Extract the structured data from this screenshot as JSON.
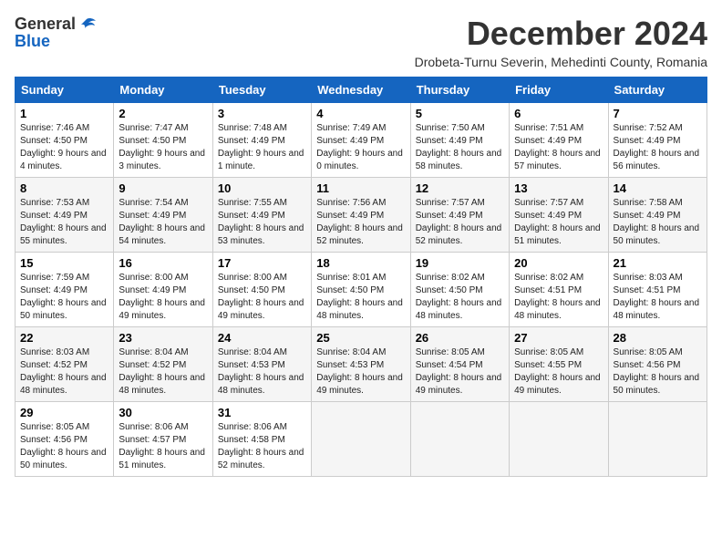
{
  "header": {
    "logo_general": "General",
    "logo_blue": "Blue",
    "title": "December 2024",
    "location": "Drobeta-Turnu Severin, Mehedinti County, Romania"
  },
  "weekdays": [
    "Sunday",
    "Monday",
    "Tuesday",
    "Wednesday",
    "Thursday",
    "Friday",
    "Saturday"
  ],
  "weeks": [
    [
      {
        "day": "1",
        "sunrise": "7:46 AM",
        "sunset": "4:50 PM",
        "daylight": "9 hours and 4 minutes."
      },
      {
        "day": "2",
        "sunrise": "7:47 AM",
        "sunset": "4:50 PM",
        "daylight": "9 hours and 3 minutes."
      },
      {
        "day": "3",
        "sunrise": "7:48 AM",
        "sunset": "4:49 PM",
        "daylight": "9 hours and 1 minute."
      },
      {
        "day": "4",
        "sunrise": "7:49 AM",
        "sunset": "4:49 PM",
        "daylight": "9 hours and 0 minutes."
      },
      {
        "day": "5",
        "sunrise": "7:50 AM",
        "sunset": "4:49 PM",
        "daylight": "8 hours and 58 minutes."
      },
      {
        "day": "6",
        "sunrise": "7:51 AM",
        "sunset": "4:49 PM",
        "daylight": "8 hours and 57 minutes."
      },
      {
        "day": "7",
        "sunrise": "7:52 AM",
        "sunset": "4:49 PM",
        "daylight": "8 hours and 56 minutes."
      }
    ],
    [
      {
        "day": "8",
        "sunrise": "7:53 AM",
        "sunset": "4:49 PM",
        "daylight": "8 hours and 55 minutes."
      },
      {
        "day": "9",
        "sunrise": "7:54 AM",
        "sunset": "4:49 PM",
        "daylight": "8 hours and 54 minutes."
      },
      {
        "day": "10",
        "sunrise": "7:55 AM",
        "sunset": "4:49 PM",
        "daylight": "8 hours and 53 minutes."
      },
      {
        "day": "11",
        "sunrise": "7:56 AM",
        "sunset": "4:49 PM",
        "daylight": "8 hours and 52 minutes."
      },
      {
        "day": "12",
        "sunrise": "7:57 AM",
        "sunset": "4:49 PM",
        "daylight": "8 hours and 52 minutes."
      },
      {
        "day": "13",
        "sunrise": "7:57 AM",
        "sunset": "4:49 PM",
        "daylight": "8 hours and 51 minutes."
      },
      {
        "day": "14",
        "sunrise": "7:58 AM",
        "sunset": "4:49 PM",
        "daylight": "8 hours and 50 minutes."
      }
    ],
    [
      {
        "day": "15",
        "sunrise": "7:59 AM",
        "sunset": "4:49 PM",
        "daylight": "8 hours and 50 minutes."
      },
      {
        "day": "16",
        "sunrise": "8:00 AM",
        "sunset": "4:49 PM",
        "daylight": "8 hours and 49 minutes."
      },
      {
        "day": "17",
        "sunrise": "8:00 AM",
        "sunset": "4:50 PM",
        "daylight": "8 hours and 49 minutes."
      },
      {
        "day": "18",
        "sunrise": "8:01 AM",
        "sunset": "4:50 PM",
        "daylight": "8 hours and 48 minutes."
      },
      {
        "day": "19",
        "sunrise": "8:02 AM",
        "sunset": "4:50 PM",
        "daylight": "8 hours and 48 minutes."
      },
      {
        "day": "20",
        "sunrise": "8:02 AM",
        "sunset": "4:51 PM",
        "daylight": "8 hours and 48 minutes."
      },
      {
        "day": "21",
        "sunrise": "8:03 AM",
        "sunset": "4:51 PM",
        "daylight": "8 hours and 48 minutes."
      }
    ],
    [
      {
        "day": "22",
        "sunrise": "8:03 AM",
        "sunset": "4:52 PM",
        "daylight": "8 hours and 48 minutes."
      },
      {
        "day": "23",
        "sunrise": "8:04 AM",
        "sunset": "4:52 PM",
        "daylight": "8 hours and 48 minutes."
      },
      {
        "day": "24",
        "sunrise": "8:04 AM",
        "sunset": "4:53 PM",
        "daylight": "8 hours and 48 minutes."
      },
      {
        "day": "25",
        "sunrise": "8:04 AM",
        "sunset": "4:53 PM",
        "daylight": "8 hours and 49 minutes."
      },
      {
        "day": "26",
        "sunrise": "8:05 AM",
        "sunset": "4:54 PM",
        "daylight": "8 hours and 49 minutes."
      },
      {
        "day": "27",
        "sunrise": "8:05 AM",
        "sunset": "4:55 PM",
        "daylight": "8 hours and 49 minutes."
      },
      {
        "day": "28",
        "sunrise": "8:05 AM",
        "sunset": "4:56 PM",
        "daylight": "8 hours and 50 minutes."
      }
    ],
    [
      {
        "day": "29",
        "sunrise": "8:05 AM",
        "sunset": "4:56 PM",
        "daylight": "8 hours and 50 minutes."
      },
      {
        "day": "30",
        "sunrise": "8:06 AM",
        "sunset": "4:57 PM",
        "daylight": "8 hours and 51 minutes."
      },
      {
        "day": "31",
        "sunrise": "8:06 AM",
        "sunset": "4:58 PM",
        "daylight": "8 hours and 52 minutes."
      },
      null,
      null,
      null,
      null
    ]
  ]
}
